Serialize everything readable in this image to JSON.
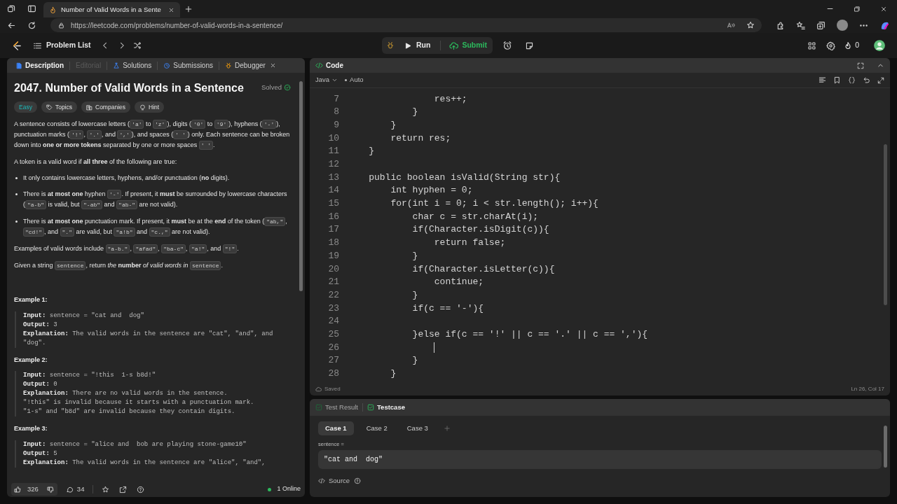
{
  "browser": {
    "tab_title": "Number of Valid Words in a Sente",
    "url": "https://leetcode.com/problems/number-of-valid-words-in-a-sentence/"
  },
  "nav": {
    "problem_list": "Problem List",
    "run": "Run",
    "submit": "Submit",
    "streak": "0"
  },
  "left_tabs": [
    {
      "label": "Description",
      "selected": true,
      "disabled": false,
      "kind": "description"
    },
    {
      "label": "Editorial",
      "selected": false,
      "disabled": true,
      "kind": "editorial"
    },
    {
      "label": "Solutions",
      "selected": false,
      "disabled": false,
      "kind": "solutions"
    },
    {
      "label": "Submissions",
      "selected": false,
      "disabled": false,
      "kind": "submissions"
    },
    {
      "label": "Debugger",
      "selected": false,
      "disabled": false,
      "kind": "debugger",
      "closable": true
    }
  ],
  "problem": {
    "title": "2047. Number of Valid Words in a Sentence",
    "status": "Solved",
    "tags": [
      {
        "kind": "difficulty",
        "label": "Easy"
      },
      {
        "kind": "topics",
        "label": "Topics"
      },
      {
        "kind": "companies",
        "label": "Companies"
      },
      {
        "kind": "hint",
        "label": "Hint"
      }
    ],
    "blocks": [
      {
        "kind": "paragraph",
        "segments": [
          {
            "kind": "text",
            "text": "A sentence consists of lowercase letters ("
          },
          {
            "kind": "code",
            "text": "'a'"
          },
          {
            "kind": "text",
            "text": " to "
          },
          {
            "kind": "code",
            "text": "'z'"
          },
          {
            "kind": "text",
            "text": "), digits ("
          },
          {
            "kind": "code",
            "text": "'0'"
          },
          {
            "kind": "text",
            "text": " to "
          },
          {
            "kind": "code",
            "text": "'9'"
          },
          {
            "kind": "text",
            "text": "), hyphens ("
          },
          {
            "kind": "code",
            "text": "'-'"
          },
          {
            "kind": "text",
            "text": "), punctuation marks ("
          },
          {
            "kind": "code",
            "text": "'!'"
          },
          {
            "kind": "text",
            "text": ", "
          },
          {
            "kind": "code",
            "text": "'.'"
          },
          {
            "kind": "text",
            "text": ", and "
          },
          {
            "kind": "code",
            "text": "','"
          },
          {
            "kind": "text",
            "text": "), and spaces ("
          },
          {
            "kind": "code",
            "text": "' '"
          },
          {
            "kind": "text",
            "text": ") only. Each sentence can be broken down into **one or more tokens** separated by one or more spaces "
          },
          {
            "kind": "code",
            "text": "' '"
          },
          {
            "kind": "text",
            "text": "."
          }
        ]
      },
      {
        "kind": "paragraph",
        "segments": [
          {
            "kind": "text",
            "text": "A token is a valid word if **all three** of the following are true:"
          }
        ]
      },
      {
        "kind": "bullet",
        "segments": [
          {
            "kind": "text",
            "text": "It only contains lowercase letters, hyphens, and/or punctuation (**no** digits)."
          }
        ]
      },
      {
        "kind": "bullet",
        "segments": [
          {
            "kind": "text",
            "text": "There is **at most one** hyphen "
          },
          {
            "kind": "code",
            "text": "'-'"
          },
          {
            "kind": "text",
            "text": ". If present, it **must** be surrounded by lowercase characters ("
          },
          {
            "kind": "code",
            "text": "\"a-b\""
          },
          {
            "kind": "text",
            "text": " is valid, but "
          },
          {
            "kind": "code",
            "text": "\"-ab\""
          },
          {
            "kind": "text",
            "text": " and "
          },
          {
            "kind": "code",
            "text": "\"ab-\""
          },
          {
            "kind": "text",
            "text": " are not valid)."
          }
        ]
      },
      {
        "kind": "bullet",
        "segments": [
          {
            "kind": "text",
            "text": "There is **at most one** punctuation mark. If present, it **must** be at the **end** of the token ("
          },
          {
            "kind": "code",
            "text": "\"ab,\""
          },
          {
            "kind": "text",
            "text": ", "
          },
          {
            "kind": "code",
            "text": "\"cd!\""
          },
          {
            "kind": "text",
            "text": ", and "
          },
          {
            "kind": "code",
            "text": "\".\""
          },
          {
            "kind": "text",
            "text": " are valid, but "
          },
          {
            "kind": "code",
            "text": "\"a!b\""
          },
          {
            "kind": "text",
            "text": " and "
          },
          {
            "kind": "code",
            "text": "\"c.,\""
          },
          {
            "kind": "text",
            "text": " are not valid)."
          }
        ]
      },
      {
        "kind": "paragraph",
        "segments": [
          {
            "kind": "text",
            "text": "Examples of valid words include "
          },
          {
            "kind": "code",
            "text": "\"a-b.\""
          },
          {
            "kind": "text",
            "text": ", "
          },
          {
            "kind": "code",
            "text": "\"afad\""
          },
          {
            "kind": "text",
            "text": ", "
          },
          {
            "kind": "code",
            "text": "\"ba-c\""
          },
          {
            "kind": "text",
            "text": ", "
          },
          {
            "kind": "code",
            "text": "\"a!\""
          },
          {
            "kind": "text",
            "text": ", and "
          },
          {
            "kind": "code",
            "text": "\"!\""
          },
          {
            "kind": "text",
            "text": "."
          }
        ]
      },
      {
        "kind": "paragraph",
        "segments": [
          {
            "kind": "text",
            "text": "Given a string "
          },
          {
            "kind": "code",
            "text": "sentence"
          },
          {
            "kind": "text",
            "text": ", return *the* **number** *of valid words in* "
          },
          {
            "kind": "code",
            "text": "sentence"
          },
          {
            "kind": "text",
            "text": "."
          }
        ]
      }
    ],
    "examples": [
      {
        "title": "Example 1:",
        "lines": [
          {
            "label": "Input:",
            "value": "sentence = \"cat and  dog\""
          },
          {
            "label": "Output:",
            "value": "3"
          },
          {
            "label": "Explanation:",
            "value": "The valid words in the sentence are \"cat\", \"and\", and \"dog\"."
          }
        ]
      },
      {
        "title": "Example 2:",
        "lines": [
          {
            "label": "Input:",
            "value": "sentence = \"!this  1-s b8d!\""
          },
          {
            "label": "Output:",
            "value": "0"
          },
          {
            "label": "Explanation:",
            "value": "There are no valid words in the sentence.\n\"!this\" is invalid because it starts with a punctuation mark.\n\"1-s\" and \"b8d\" are invalid because they contain digits."
          }
        ]
      },
      {
        "title": "Example 3:",
        "lines": [
          {
            "label": "Input:",
            "value": "sentence = \"alice and  bob are playing stone-game10\""
          },
          {
            "label": "Output:",
            "value": "5"
          },
          {
            "label": "Explanation:",
            "value": "The valid words in the sentence are \"alice\", \"and\","
          }
        ]
      }
    ]
  },
  "footer": {
    "likes": "326",
    "comments": "34",
    "online": "1 Online"
  },
  "code": {
    "title": "Code",
    "language": "Java",
    "mode": "Auto",
    "saved": "Saved",
    "position": "Ln 26, Col 17",
    "lines": [
      {
        "n": "7",
        "text": "                res++;"
      },
      {
        "n": "8",
        "text": "            }"
      },
      {
        "n": "9",
        "text": "        }"
      },
      {
        "n": "10",
        "text": "        return res;"
      },
      {
        "n": "11",
        "text": "    }"
      },
      {
        "n": "12"
      },
      {
        "n": "13",
        "text": "    public boolean isValid(String str){"
      },
      {
        "n": "14",
        "text": "        int hyphen = 0;"
      },
      {
        "n": "15",
        "text": "        for(int i = 0; i < str.length(); i++){"
      },
      {
        "n": "16",
        "text": "            char c = str.charAt(i);"
      },
      {
        "n": "17",
        "text": "            if(Character.isDigit(c)){"
      },
      {
        "n": "18",
        "text": "                return false;"
      },
      {
        "n": "19",
        "text": "            }"
      },
      {
        "n": "20",
        "text": "            if(Character.isLetter(c)){"
      },
      {
        "n": "21",
        "text": "                continue;"
      },
      {
        "n": "22",
        "text": "            }"
      },
      {
        "n": "23",
        "text": "            if(c == '-'){"
      },
      {
        "n": "24"
      },
      {
        "n": "25",
        "text": "            }else if(c == '!' || c == '.' || c == ','){"
      },
      {
        "n": "26",
        "cursor": true
      },
      {
        "n": "27",
        "text": "            }"
      },
      {
        "n": "28",
        "text": "        }"
      }
    ]
  },
  "test": {
    "tabs": [
      {
        "label": "Test Result",
        "selected": false
      },
      {
        "label": "Testcase",
        "selected": true
      }
    ],
    "cases": [
      {
        "label": "Case 1",
        "selected": true
      },
      {
        "label": "Case 2",
        "selected": false
      },
      {
        "label": "Case 3",
        "selected": false
      }
    ],
    "param": "sentence =",
    "value": "\"cat and  dog\"",
    "source": "Source"
  }
}
